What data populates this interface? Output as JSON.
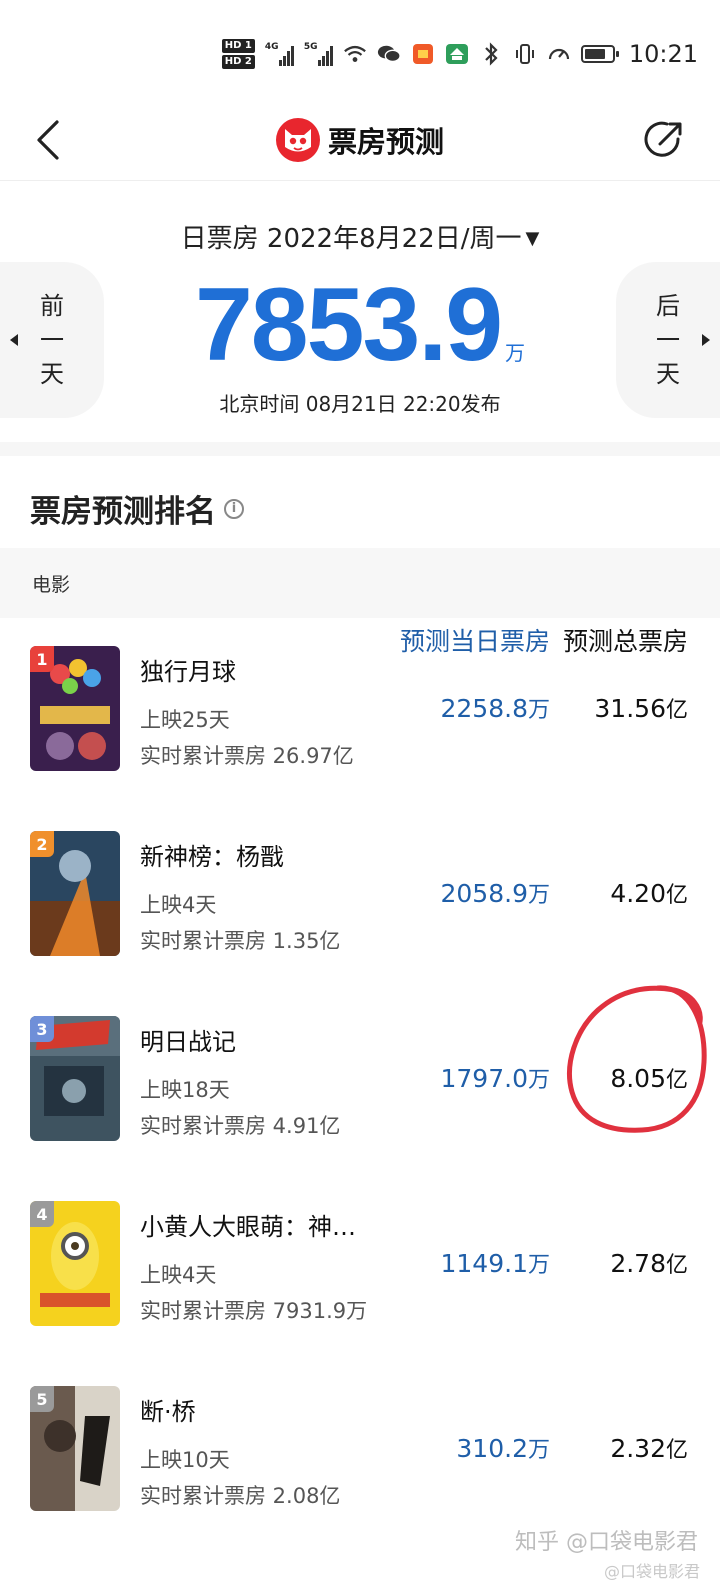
{
  "status_bar": {
    "hd1": "HD 1",
    "hd2": "HD 2",
    "sig1": "4G",
    "sig2": "5G",
    "time": "10:21",
    "battery_level": 0.75
  },
  "nav": {
    "title": "票房预测"
  },
  "summary": {
    "date_label": "日票房 2022年8月22日/周一",
    "prev_label": "前一天",
    "next_label": "后一天",
    "value": "7853.9",
    "unit": "万",
    "publish": "北京时间  08月21日  22:20发布"
  },
  "ranking": {
    "title": "票房预测排名",
    "columns": {
      "movie": "电影",
      "daily": "预测当日票房",
      "total": "预测总票房"
    },
    "rows": [
      {
        "rank": "1",
        "title": "独行月球",
        "days": "上映25天",
        "cumulative": "实时累计票房 26.97亿",
        "daily": "2258.8",
        "daily_unit": "万",
        "total": "31.56",
        "total_unit": "亿",
        "rank_color": "#e8413b"
      },
      {
        "rank": "2",
        "title": "新神榜：杨戬",
        "days": "上映4天",
        "cumulative": "实时累计票房 1.35亿",
        "daily": "2058.9",
        "daily_unit": "万",
        "total": "4.20",
        "total_unit": "亿",
        "rank_color": "#f0902c"
      },
      {
        "rank": "3",
        "title": "明日战记",
        "days": "上映18天",
        "cumulative": "实时累计票房 4.91亿",
        "daily": "1797.0",
        "daily_unit": "万",
        "total": "8.05",
        "total_unit": "亿",
        "rank_color": "#6f8fd8"
      },
      {
        "rank": "4",
        "title": "小黄人大眼萌：神…",
        "days": "上映4天",
        "cumulative": "实时累计票房 7931.9万",
        "daily": "1149.1",
        "daily_unit": "万",
        "total": "2.78",
        "total_unit": "亿",
        "rank_color": "#9a9a9a"
      },
      {
        "rank": "5",
        "title": "断·桥",
        "days": "上映10天",
        "cumulative": "实时累计票房 2.08亿",
        "daily": "310.2",
        "daily_unit": "万",
        "total": "2.32",
        "total_unit": "亿",
        "rank_color": "#9a9a9a"
      }
    ]
  },
  "watermark": {
    "line1": "知乎 @口袋电影君",
    "line2": "@口袋电影君"
  },
  "colors": {
    "accent_blue": "#1f6fd6",
    "brand_red": "#e8262e",
    "annotation_red": "#e0313e"
  }
}
